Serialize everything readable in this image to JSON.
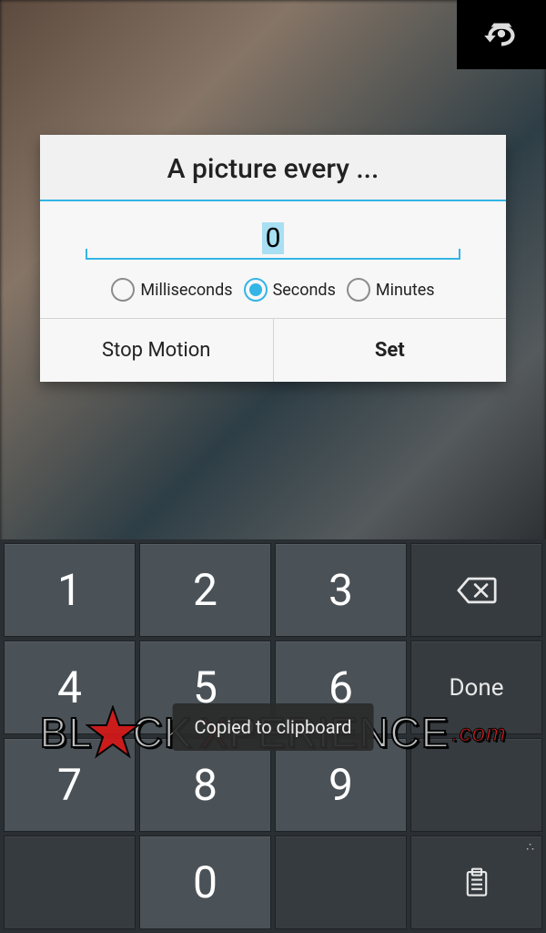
{
  "dialog": {
    "title": "A picture every ...",
    "value": "0",
    "units": {
      "ms": "Milliseconds",
      "s": "Seconds",
      "m": "Minutes",
      "selected": "s"
    },
    "buttons": {
      "left": "Stop Motion",
      "right": "Set"
    }
  },
  "keypad": {
    "keys": [
      "1",
      "2",
      "3",
      "4",
      "5",
      "6",
      "7",
      "8",
      "9",
      "0"
    ],
    "done": "Done"
  },
  "toast": {
    "text": "Copied to clipboard"
  },
  "watermark": {
    "sup": "BL",
    "line1a": "BL",
    "line1b": "CK",
    "line2a": "PERIENCE",
    "suffix": ".com"
  }
}
